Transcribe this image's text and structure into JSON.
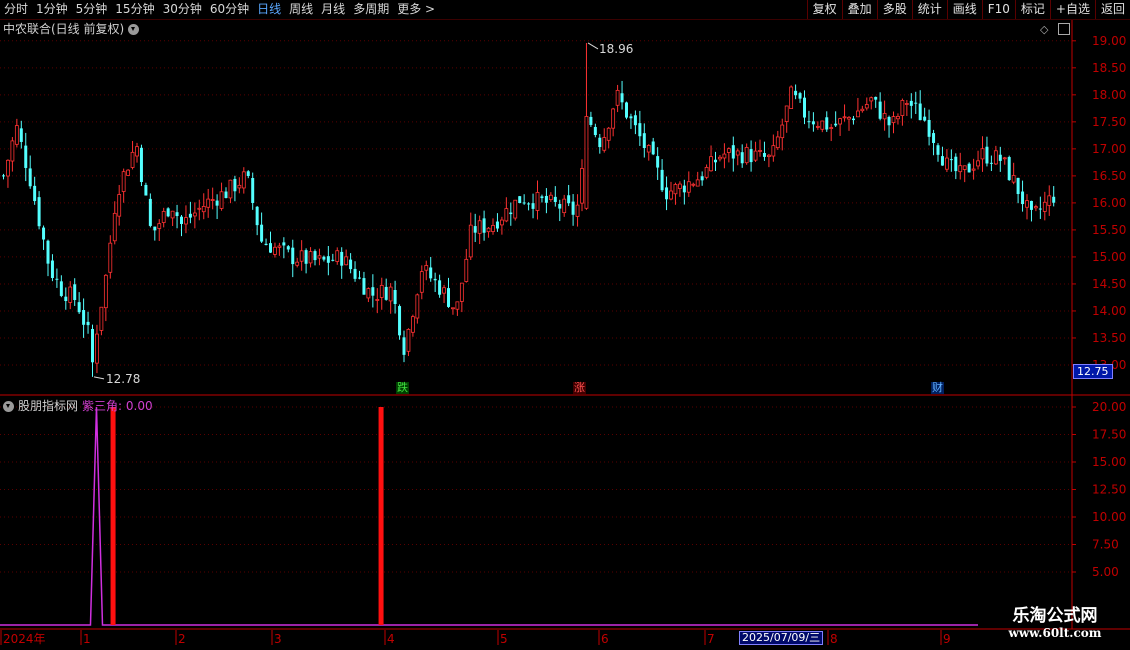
{
  "toolbar": {
    "periods": [
      "分时",
      "1分钟",
      "5分钟",
      "15分钟",
      "30分钟",
      "60分钟",
      "日线",
      "周线",
      "月线",
      "多周期",
      "更多 >"
    ],
    "active_period": "日线",
    "actions": [
      "复权",
      "叠加",
      "多股",
      "统计",
      "画线",
      "F10",
      "标记",
      "+自选",
      "返回"
    ]
  },
  "main_title": "中农联合(日线 前复权)",
  "indicator": {
    "name": "股朋指标网",
    "value_label": "紫三角: 0.00"
  },
  "markers": [
    {
      "text": "跌",
      "color": "#40e040",
      "bg": "#004000"
    },
    {
      "text": "涨",
      "color": "#ff5050",
      "bg": "#400000"
    },
    {
      "text": "财",
      "color": "#60b0ff",
      "bg": "#002060"
    }
  ],
  "current_price": "12.75",
  "cursor_date": "2025/07/09/三",
  "watermark": {
    "title": "乐淘公式网",
    "url": "www.60lt.com"
  },
  "colors": {
    "up": "#ff3232",
    "down": "#54ffff",
    "grid": "#5a0000",
    "axis": "#c00000",
    "purple": "#d030e0"
  },
  "chart_data": [
    {
      "type": "candlestick",
      "price_axis": {
        "ticks": [
          "19.00",
          "18.50",
          "18.00",
          "17.50",
          "17.00",
          "16.50",
          "16.00",
          "15.50",
          "15.00",
          "14.50",
          "14.00",
          "13.50",
          "13.00"
        ],
        "range": [
          12.5,
          19.2
        ]
      },
      "annotations": {
        "high": "18.96",
        "low": "12.78"
      },
      "key_values": {
        "high": 18.96,
        "low": 12.78,
        "last": 16.25
      },
      "bars_count": 237
    },
    {
      "type": "bar",
      "y_axis": {
        "ticks": [
          "20.00",
          "17.50",
          "15.00",
          "12.50",
          "10.00",
          "7.50",
          "5.00"
        ],
        "range": [
          0,
          21
        ]
      },
      "signals": [
        {
          "x": 0.105,
          "value": 20
        },
        {
          "x": 0.355,
          "value": 20
        }
      ],
      "purple_spike": {
        "x": 0.09,
        "value": 20
      },
      "x_labels": [
        "2024年",
        "1",
        "2",
        "3",
        "4",
        "5",
        "6",
        "7",
        "8",
        "9"
      ]
    }
  ]
}
